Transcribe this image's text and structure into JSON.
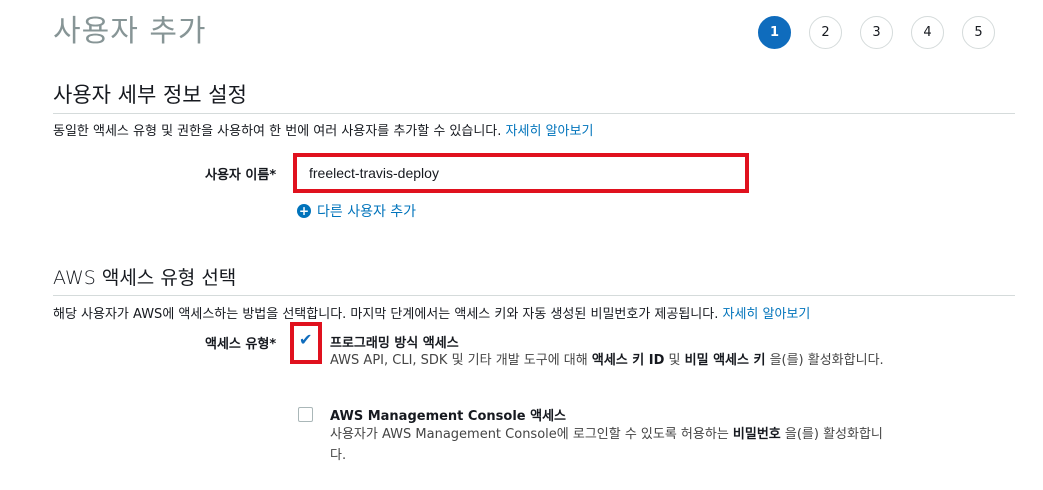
{
  "page": {
    "title": "사용자 추가"
  },
  "steps": [
    "1",
    "2",
    "3",
    "4",
    "5"
  ],
  "user_details": {
    "title": "사용자 세부 정보 설정",
    "description": "동일한 액세스 유형 및 권한을 사용하여 한 번에 여러 사용자를 추가할 수 있습니다.",
    "learn_more": "자세히 알아보기",
    "username_label": "사용자 이름*",
    "username_value": "freelect-travis-deploy",
    "add_user_label": "다른 사용자 추가"
  },
  "access_type": {
    "title": "AWS 액세스 유형 선택",
    "description": "해당 사용자가 AWS에 액세스하는 방법을 선택합니다. 마지막 단계에서는 액세스 키와 자동 생성된 비밀번호가 제공됩니다.",
    "learn_more": "자세히 알아보기",
    "label": "액세스 유형*",
    "options": [
      {
        "title": "프로그래밍 방식 액세스",
        "checked": true,
        "desc_pre": "AWS API, CLI, SDK 및 기타 개발 도구에 대해 ",
        "desc_b1": "액세스 키 ID",
        "desc_mid": " 및 ",
        "desc_b2": "비밀 액세스 키",
        "desc_post": " 을(를) 활성화합니다."
      },
      {
        "title": "AWS Management Console 액세스",
        "checked": false,
        "desc_pre": "사용자가 AWS Management Console에 로그인할 수 있도록 허용하는 ",
        "desc_b1": "비밀번호",
        "desc_post": " 을(를) 활성화합니다."
      }
    ]
  },
  "colors": {
    "accent": "#0f6cbd",
    "link": "#0073bb",
    "highlight": "#e0111e"
  }
}
